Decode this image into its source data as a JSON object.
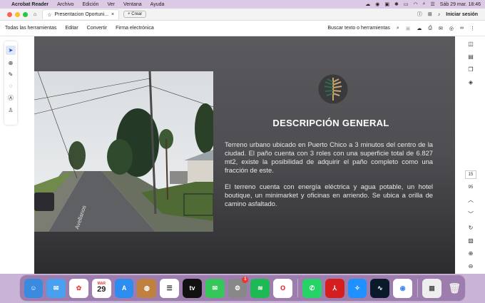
{
  "menubar": {
    "app_name": "Acrobat Reader",
    "menus": [
      "Archivo",
      "Edición",
      "Ver",
      "Ventana",
      "Ayuda"
    ],
    "datetime": "Sáb 29 mar.  18:46"
  },
  "tabbar": {
    "tab_title": "Presentacion Oportuni...",
    "new_button": "+ Crear",
    "signin": "Iniciar sesión"
  },
  "toolbar": {
    "tools": [
      "Todas las herramientas",
      "Editar",
      "Convertir",
      "Firma electrónica"
    ],
    "search_label": "Buscar texto o herramientas"
  },
  "right_rail": {
    "page_number": "15",
    "page_total": "95"
  },
  "document": {
    "title": "DESCRIPCIÓN GENERAL",
    "paragraph1": "Terreno urbano ubicado en Puerto Chico a 3 minutos del centro de la ciudad. El paño cuenta con 3 roles con una superficie total de 6.827 mt2, existe la posibilidad de adquirir el paño completo como una fracción de este.",
    "paragraph2": "El terreno cuenta con energía eléctrica y agua potable, un hotel boutique, un minimarket y oficinas en arriendo. Se ubica a orilla de camino asfaltado.",
    "street_sign": "Avellanos"
  },
  "dock": {
    "calendar_month": "MAR",
    "calendar_day": "29",
    "tv_label": "tv",
    "badge_count": "1"
  },
  "colors": {
    "accent_blue": "#1a4fc4",
    "logo_gold": "#c9a36a",
    "logo_green": "#2e6b4e"
  }
}
